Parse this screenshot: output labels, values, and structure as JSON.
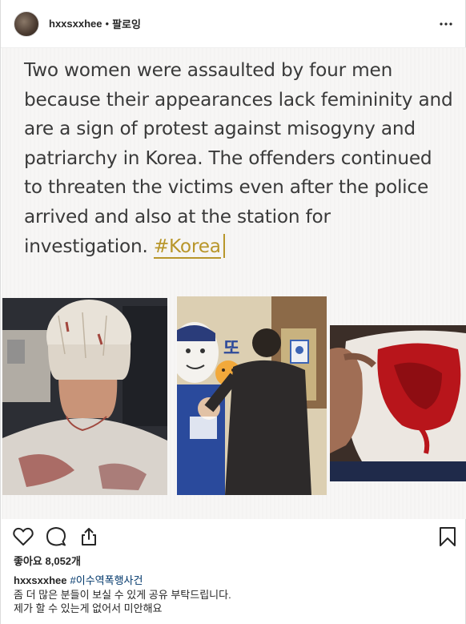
{
  "header": {
    "username": "hxxsxxhee",
    "separator": "•",
    "follow_label": "팔로잉",
    "more_icon": "more-horizontal-icon"
  },
  "media": {
    "text_lines": [
      "Two women were assaulted by four men",
      "because their appearances lack femininity and",
      "are a sign of protest against misogyny and",
      "patriarchy in Korea. The offenders continued",
      "to threaten the victims even after the police",
      "arrived and also at the station for",
      "investigation. "
    ],
    "hashtag": "#Korea",
    "hashtag_color": "#b8962b",
    "photo2_sign": "또"
  },
  "actions": {
    "like_icon": "heart-icon",
    "comment_icon": "comment-icon",
    "share_icon": "share-icon",
    "save_icon": "bookmark-icon"
  },
  "likes": {
    "text": "좋아요 8,052개"
  },
  "caption": {
    "username": "hxxsxxhee",
    "hashtag": "#이수역폭행사건",
    "lines": [
      "좀 더 많은 분들이 보실 수 있게 공유 부탁드립니다.",
      "제가 할 수 있는게 없어서 미안해요"
    ],
    "link_color": "#00376b"
  }
}
